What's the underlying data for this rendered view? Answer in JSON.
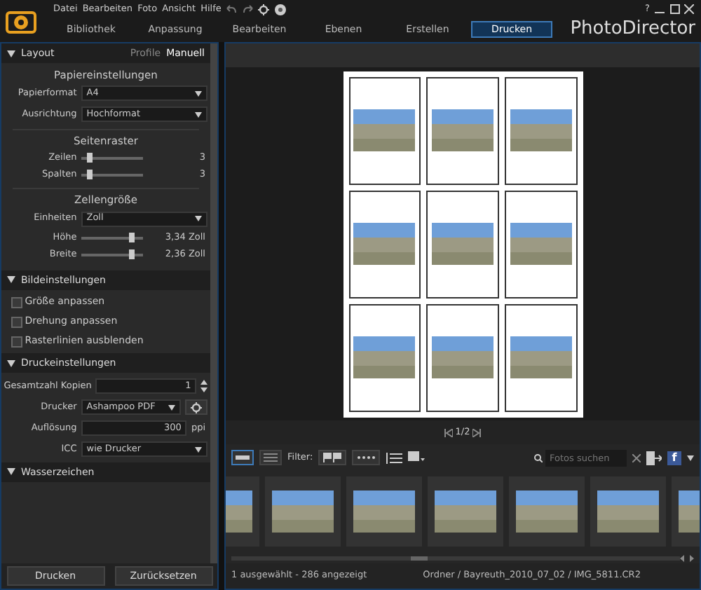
{
  "menu": [
    "Datei",
    "Bearbeiten",
    "Foto",
    "Ansicht",
    "Hilfe"
  ],
  "help_label": "?",
  "tabs": [
    {
      "label": "Bibliothek",
      "selected": false
    },
    {
      "label": "Anpassung",
      "selected": false
    },
    {
      "label": "Bearbeiten",
      "selected": false
    },
    {
      "label": "Ebenen",
      "selected": false
    },
    {
      "label": "Erstellen",
      "selected": false
    },
    {
      "label": "Drucken",
      "selected": true
    }
  ],
  "app_title": "PhotoDirector",
  "layout": {
    "title": "Layout",
    "expanded": true,
    "modes": [
      {
        "label": "Profile",
        "selected": false
      },
      {
        "label": "Manuell",
        "selected": true
      }
    ],
    "paper": {
      "heading": "Papiereinstellungen",
      "fields": [
        {
          "label": "Papierformat",
          "value": "A4"
        },
        {
          "label": "Ausrichtung",
          "value": "Hochformat"
        }
      ]
    },
    "grid": {
      "heading": "Seitenraster",
      "sliders": [
        {
          "label": "Zeilen",
          "level": 0.15,
          "reading": "3"
        },
        {
          "label": "Spalten",
          "level": 0.15,
          "reading": "3"
        }
      ]
    },
    "cell_size": {
      "heading": "Zellengröße",
      "units": {
        "label": "Einheiten",
        "value": "Zoll"
      },
      "sliders": [
        {
          "label": "Höhe",
          "level": 0.82,
          "reading": "3,34 Zoll"
        },
        {
          "label": "Breite",
          "level": 0.82,
          "reading": "2,36 Zoll"
        }
      ]
    }
  },
  "image_settings": {
    "title": "Bildeinstellungen",
    "expanded": true,
    "options": [
      {
        "label": "Größe anpassen",
        "checked": false
      },
      {
        "label": "Drehung anpassen",
        "checked": false
      },
      {
        "label": "Rasterlinien ausblenden",
        "checked": false
      }
    ]
  },
  "print_settings": {
    "title": "Druckeinstellungen",
    "expanded": true,
    "copies": {
      "label": "Gesamtzahl Kopien",
      "value": "1"
    },
    "printer": {
      "label": "Drucker",
      "value": "Ashampoo PDF"
    },
    "resolution": {
      "label": "Auflösung",
      "value": "300",
      "unit": "ppi"
    },
    "icc": {
      "label": "ICC",
      "value": "wie Drucker"
    }
  },
  "watermark": {
    "title": "Wasserzeichen",
    "expanded": true
  },
  "buttons": [
    "Drucken",
    "Zurücksetzen"
  ],
  "page_cells": [
    {
      "kind": "photo"
    },
    {
      "kind": "photo"
    },
    {
      "kind": "photo"
    },
    {
      "kind": "photo"
    },
    {
      "kind": "photo"
    },
    {
      "kind": "photo"
    },
    {
      "kind": "photo"
    },
    {
      "kind": "photo"
    },
    {
      "kind": "photo"
    }
  ],
  "page_nav": "1/2",
  "toolbar": {
    "filter_label": "Filter:",
    "search": {
      "placeholder": "Fotos suchen"
    },
    "share_label": "f"
  },
  "filmstrip": [
    {
      "kind": "photo"
    },
    {
      "kind": "photo"
    },
    {
      "kind": "photo"
    },
    {
      "kind": "photo"
    },
    {
      "kind": "photo"
    },
    {
      "kind": "photo"
    },
    {
      "kind": "photo"
    }
  ],
  "status_bar": {
    "selection": "1 ausgewählt - 286 angezeigt",
    "path": "Ordner / Bayreuth_2010_07_02 / IMG_5811.CR2"
  }
}
